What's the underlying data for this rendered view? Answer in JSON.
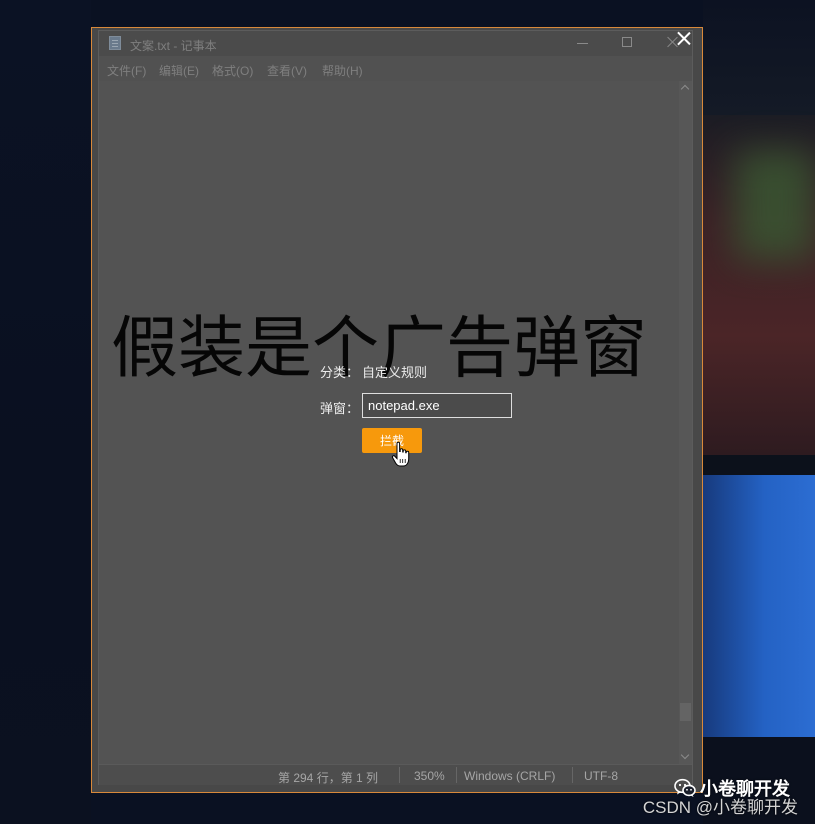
{
  "colors": {
    "accent": "#f7990c",
    "dialog_border": "#d8893a",
    "overlay": "#484848"
  },
  "notepad": {
    "title": "文案.txt - 记事本",
    "icon": "notepad-icon",
    "menu": [
      {
        "label": "文件(F)"
      },
      {
        "label": "编辑(E)"
      },
      {
        "label": "格式(O)"
      },
      {
        "label": "查看(V)"
      },
      {
        "label": "帮助(H)"
      }
    ],
    "content": "假装是个广告弹窗",
    "status": {
      "position": "第 294 行，第 1 列",
      "zoom": "350%",
      "line_ending": "Windows (CRLF)",
      "encoding": "UTF-8"
    }
  },
  "dialog": {
    "category_label": "分类：",
    "category_value": "自定义规则",
    "popup_label": "弹窗：",
    "popup_value": "notepad.exe",
    "block_button": "拦截",
    "close_icon": "close-icon",
    "cursor_icon": "hand-pointer-icon"
  },
  "watermark": {
    "icon": "wechat-icon",
    "account": "小卷聊开发",
    "source": "CSDN @小卷聊开发"
  }
}
